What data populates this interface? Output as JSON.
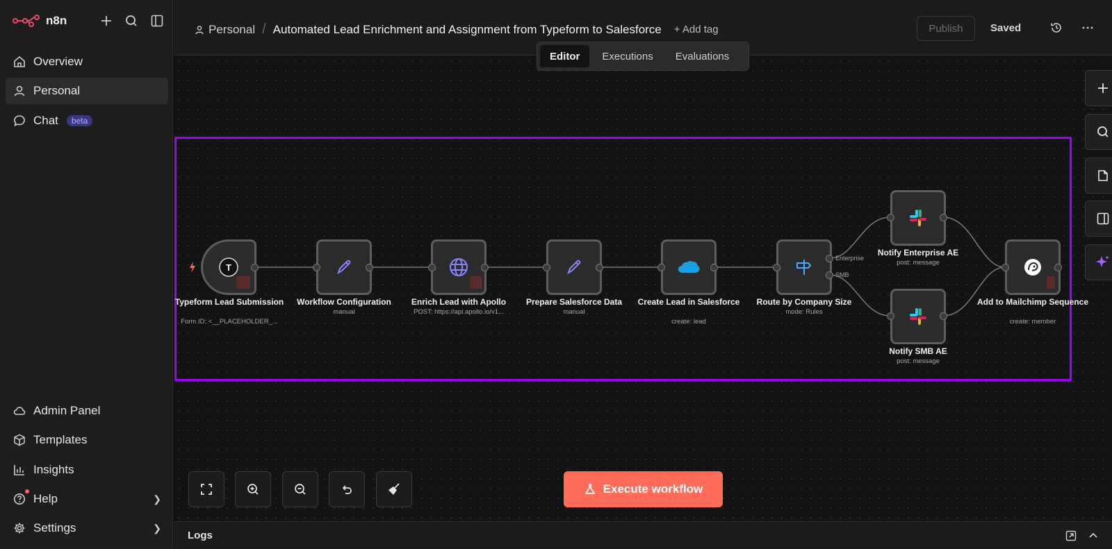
{
  "app": {
    "name": "n8n"
  },
  "sidebar": {
    "top_items": [
      {
        "label": "Overview",
        "icon": "home-icon"
      },
      {
        "label": "Personal",
        "icon": "user-icon",
        "active": true
      },
      {
        "label": "Chat",
        "icon": "chat-icon",
        "badge": "beta"
      }
    ],
    "bottom_items": [
      {
        "label": "Admin Panel",
        "icon": "cloud-icon"
      },
      {
        "label": "Templates",
        "icon": "box-icon"
      },
      {
        "label": "Insights",
        "icon": "bar-chart-icon"
      },
      {
        "label": "Help",
        "icon": "question-icon",
        "has_submenu": true
      },
      {
        "label": "Settings",
        "icon": "gear-icon",
        "has_submenu": true
      }
    ]
  },
  "header": {
    "project": "Personal",
    "separator": "/",
    "title": "Automated Lead Enrichment and Assignment from Typeform to Salesforce",
    "add_tag": "+ Add tag",
    "publish": "Publish",
    "saved": "Saved"
  },
  "tabs": [
    "Editor",
    "Executions",
    "Evaluations"
  ],
  "active_tab": "Editor",
  "nodes": [
    {
      "label": "Typeform Lead Submission",
      "sub": "Form ID: <__PLACEHOLDER_...",
      "icon": "typeform-icon"
    },
    {
      "label": "Workflow Configuration",
      "sub": "manual",
      "icon": "pencil-icon"
    },
    {
      "label": "Enrich Lead with Apollo",
      "sub": "POST: https://api.apollo.io/v1...",
      "icon": "globe-icon"
    },
    {
      "label": "Prepare Salesforce Data",
      "sub": "manual",
      "icon": "pencil-icon"
    },
    {
      "label": "Create Lead in Salesforce",
      "sub": "create: lead",
      "icon": "salesforce-icon"
    },
    {
      "label": "Route by Company Size",
      "sub": "mode: Rules",
      "icon": "signpost-icon",
      "outputs": [
        "Enterprise",
        "SMB"
      ]
    },
    {
      "label": "Notify Enterprise AE",
      "sub": "post: message",
      "icon": "slack-icon"
    },
    {
      "label": "Notify SMB AE",
      "sub": "post: message",
      "icon": "slack-icon"
    },
    {
      "label": "Add to Mailchimp Sequence",
      "sub": "create: member",
      "icon": "mailchimp-icon"
    }
  ],
  "execute_button": "Execute workflow",
  "logs": {
    "title": "Logs"
  },
  "colors": {
    "accent": "#ff6d5a",
    "selection": "#a100ff",
    "canvas": "#131313",
    "sidebar": "#1d1d1d"
  }
}
